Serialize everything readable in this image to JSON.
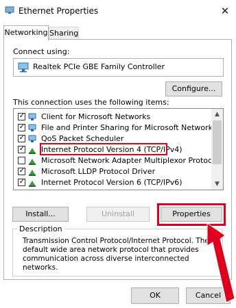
{
  "window": {
    "title": "Ethernet Properties",
    "close_glyph": "✕"
  },
  "tabs": [
    {
      "label": "Networking",
      "active": true
    },
    {
      "label": "Sharing",
      "active": false
    }
  ],
  "connect_using": {
    "label": "Connect using:",
    "adapter": "Realtek PCIe GBE Family Controller",
    "configure_button": "Configure..."
  },
  "items_section": {
    "label": "This connection uses the following items:",
    "items": [
      {
        "label": "Client for Microsoft Networks",
        "checked": true,
        "icon": "network-client-icon"
      },
      {
        "label": "File and Printer Sharing for Microsoft Networks",
        "checked": true,
        "icon": "file-printer-sharing-icon"
      },
      {
        "label": "QoS Packet Scheduler",
        "checked": true,
        "icon": "qos-icon"
      },
      {
        "label": "Internet Protocol Version 4 (TCP/IPv4)",
        "checked": true,
        "icon": "protocol-icon",
        "highlighted": true
      },
      {
        "label": "Microsoft Network Adapter Multiplexor Protocol",
        "checked": false,
        "icon": "protocol-icon"
      },
      {
        "label": "Microsoft LLDP Protocol Driver",
        "checked": true,
        "icon": "protocol-icon"
      },
      {
        "label": "Internet Protocol Version 6 (TCP/IPv6)",
        "checked": true,
        "icon": "protocol-icon"
      }
    ]
  },
  "actions": {
    "install": "Install...",
    "uninstall": "Uninstall",
    "properties": "Properties"
  },
  "description": {
    "label": "Description",
    "text": "Transmission Control Protocol/Internet Protocol. The default wide area network protocol that provides communication across diverse interconnected networks."
  },
  "dialog_buttons": {
    "ok": "OK",
    "cancel": "Cancel"
  },
  "colors": {
    "highlight": "#e0001b",
    "accent_arrow": "#e0001b"
  }
}
